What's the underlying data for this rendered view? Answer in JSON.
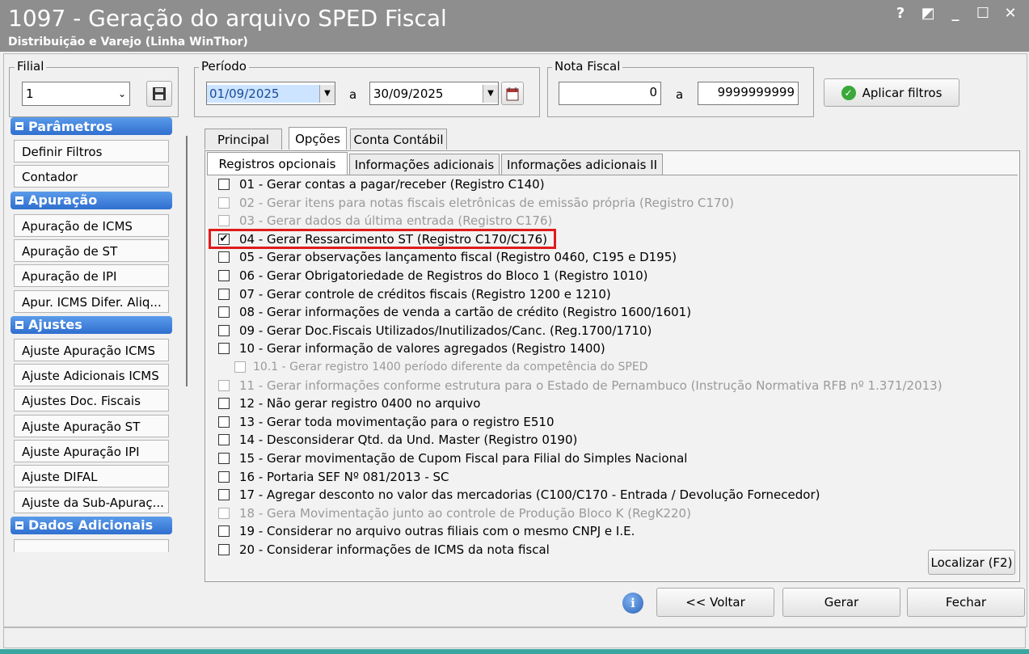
{
  "window": {
    "title": "1097 - Geração do arquivo SPED Fiscal",
    "subtitle": "Distribuição e Varejo (Linha WinThor)",
    "help": "?",
    "restore": "◩",
    "minimize": "_",
    "maximize": "☐",
    "close": "✕"
  },
  "filial": {
    "legend": "Filial",
    "value": "1"
  },
  "periodo": {
    "legend": "Período",
    "start": "01/09/2025",
    "separator": "a",
    "end": "30/09/2025"
  },
  "nota_fiscal": {
    "legend": "Nota Fiscal",
    "start": "0",
    "separator": "a",
    "end": "9999999999"
  },
  "apply_filters": "Aplicar filtros",
  "sidebar": {
    "sections": [
      {
        "title": "Parâmetros",
        "items": [
          "Definir Filtros",
          "Contador"
        ]
      },
      {
        "title": "Apuração",
        "items": [
          "Apuração de ICMS",
          "Apuração de ST",
          "Apuração de IPI",
          "Apur. ICMS Difer. Aliq..."
        ]
      },
      {
        "title": "Ajustes",
        "items": [
          "Ajuste Apuração ICMS",
          "Ajuste Adicionais ICMS",
          "Ajustes Doc. Fiscais",
          "Ajuste Apuração ST",
          "Ajuste Apuração IPI",
          "Ajuste DIFAL",
          "Ajuste da Sub-Apuraç..."
        ]
      },
      {
        "title": "Dados Adicionais",
        "items": []
      }
    ]
  },
  "tabs": [
    "Principal",
    "Opções",
    "Conta Contábil"
  ],
  "subtabs": [
    "Registros opcionais",
    "Informações adicionais",
    "Informações adicionais II"
  ],
  "options": [
    {
      "label": "01 - Gerar contas a pagar/receber (Registro C140)",
      "checked": false,
      "enabled": true
    },
    {
      "label": "02 - Gerar itens para notas fiscais eletrônicas de emissão própria (Registro C170)",
      "checked": false,
      "enabled": false
    },
    {
      "label": "03 - Gerar dados da última entrada (Registro C176)",
      "checked": false,
      "enabled": false
    },
    {
      "label": "04 - Gerar Ressarcimento ST (Registro C170/C176)",
      "checked": true,
      "enabled": true
    },
    {
      "label": "05 - Gerar observações lançamento fiscal (Registro 0460, C195 e D195)",
      "checked": false,
      "enabled": true
    },
    {
      "label": "06 - Gerar Obrigatoriedade de Registros do Bloco 1 (Registro  1010)",
      "checked": false,
      "enabled": true
    },
    {
      "label": "07 - Gerar controle de créditos fiscais (Registro 1200 e 1210)",
      "checked": false,
      "enabled": true
    },
    {
      "label": "08 - Gerar informações de venda a cartão de crédito (Registro 1600/1601)",
      "checked": false,
      "enabled": true
    },
    {
      "label": "09 - Gerar Doc.Fiscais Utilizados/Inutilizados/Canc. (Reg.1700/1710)",
      "checked": false,
      "enabled": true
    },
    {
      "label": "10 - Gerar informação de valores agregados (Registro 1400)",
      "checked": false,
      "enabled": true
    },
    {
      "label": "10.1 - Gerar registro 1400 período diferente da competência do SPED",
      "checked": false,
      "enabled": false,
      "indent": true
    },
    {
      "label": "11 - Gerar informações conforme estrutura para o Estado de Pernambuco (Instrução Normativa RFB nº 1.371/2013)",
      "checked": false,
      "enabled": false
    },
    {
      "label": "12 - Não gerar registro 0400 no arquivo",
      "checked": false,
      "enabled": true
    },
    {
      "label": "13 - Gerar toda movimentação para o registro E510",
      "checked": false,
      "enabled": true
    },
    {
      "label": "14 - Desconsiderar Qtd. da Und. Master (Registro 0190)",
      "checked": false,
      "enabled": true
    },
    {
      "label": "15 - Gerar movimentação de Cupom Fiscal para Filial do Simples Nacional",
      "checked": false,
      "enabled": true
    },
    {
      "label": "16 - Portaria SEF Nº 081/2013 - SC",
      "checked": false,
      "enabled": true
    },
    {
      "label": "17 - Agregar desconto no valor das mercadorias (C100/C170 - Entrada / Devolução Fornecedor)",
      "checked": false,
      "enabled": true
    },
    {
      "label": "18 - Gera Movimentação junto ao controle de Produção Bloco K (RegK220)",
      "checked": false,
      "enabled": false
    },
    {
      "label": "19 - Considerar no arquivo outras filiais com o mesmo CNPJ e I.E.",
      "checked": false,
      "enabled": true
    },
    {
      "label": "20 - Considerar informações de ICMS da nota fiscal",
      "checked": false,
      "enabled": true
    }
  ],
  "localizar": "Localizar (F2)",
  "info_icon": "i",
  "footer": {
    "voltar": "<< Voltar",
    "gerar": "Gerar",
    "fechar": "Fechar"
  },
  "colors": {
    "accent_blue": "#2f6fcf",
    "highlight_red": "#e01b1b",
    "titlebar": "#8e8e8e"
  }
}
